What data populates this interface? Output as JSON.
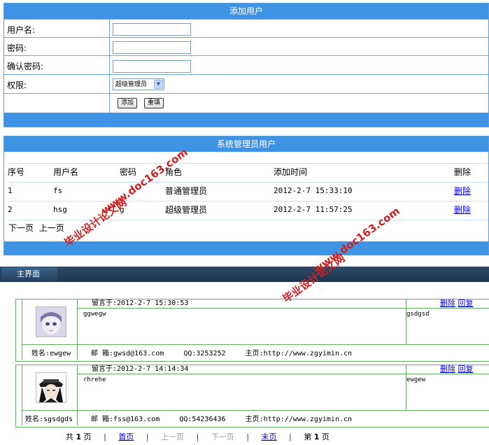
{
  "add_user": {
    "title": "添加用户",
    "username_label": "用户名:",
    "password_label": "密码:",
    "confirm_label": "确认密码:",
    "role_label": "权限:",
    "role_selected": "超级管理员",
    "add_button": "添加",
    "reset_button": "重填"
  },
  "admin_list": {
    "title": "系统管理员用户",
    "headers": [
      "序号",
      "用户名",
      "密码",
      "角色",
      "添加时间",
      "删除"
    ],
    "rows": [
      {
        "id": "1",
        "username": "fs",
        "password": "",
        "role": "普通管理员",
        "time": "2012-2-7 15:33:10",
        "action": "删除"
      },
      {
        "id": "2",
        "username": "hsg",
        "password": "g",
        "role": "超级管理员",
        "time": "2012-2-7 11:57:25",
        "action": "删除"
      }
    ],
    "pager_next": "下一页",
    "pager_prev": "上一页"
  },
  "main": {
    "tab_label": "主界面",
    "messages": [
      {
        "time": "留言于:2012-2-7 15:30:53",
        "delete": "删除",
        "reply": "回复",
        "content": "ggwegw",
        "reply_text": "gsdgsd",
        "name": "姓名:ewgew",
        "email": "邮 箱:gwsd@163.com",
        "qq": "QQ:3253252",
        "homepage": "主页:http://www.zgyimin.cn"
      },
      {
        "time": "留言于:2012-2-7 14:14:34",
        "delete": "删除",
        "reply": "回复",
        "content": "rhrehe",
        "reply_text": "ewgew",
        "name": "姓名:sgsdgds",
        "email": "邮 箱:fss@163.com",
        "qq": "QQ:54236436",
        "homepage": "主页:http://www.zgyimin.cn"
      }
    ],
    "pager": {
      "total_prefix": "共",
      "total_pages": "1",
      "total_suffix": "页",
      "first": "首页",
      "prev": "上一页",
      "next": "下一页",
      "last": "末页",
      "current_prefix": "第",
      "current_page": "1",
      "current_suffix": "页"
    }
  },
  "watermark": {
    "site": "www.doc163.com",
    "cn": "毕业设计论文网"
  }
}
